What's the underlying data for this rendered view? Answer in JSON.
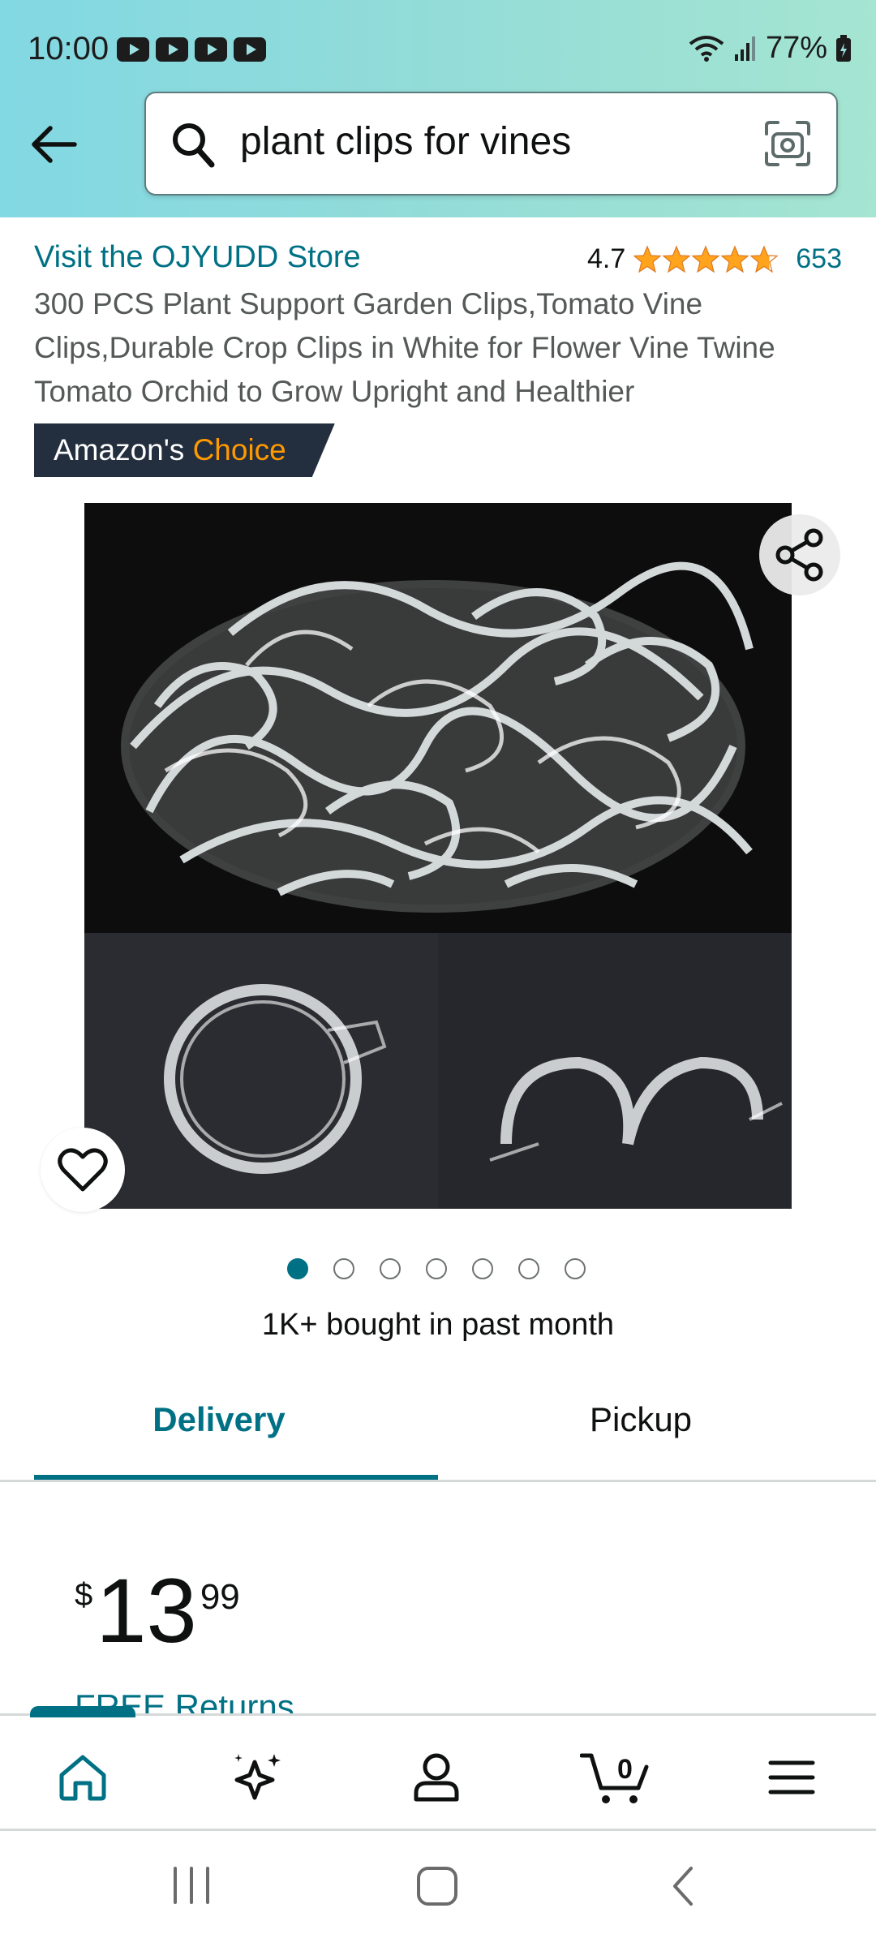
{
  "status_bar": {
    "time": "10:00",
    "notification_icons": [
      "youtube-icon",
      "youtube-icon",
      "youtube-icon",
      "youtube-icon"
    ],
    "battery": "77%"
  },
  "search": {
    "query": "plant clips for vines"
  },
  "product": {
    "store_link": "Visit the OJYUDD Store",
    "rating": "4.7",
    "rating_stars": 4.7,
    "rating_count": "653",
    "title": "300 PCS Plant Support Garden Clips,Tomato Vine Clips,Durable Crop Clips in White for Flower Vine Twine Tomato Orchid to Grow Upright and Healthier",
    "badge_prefix": "Amazon's",
    "badge_highlight": "Choice",
    "image_count": 7,
    "active_image_index": 0,
    "bought_text": "1K+ bought in past month"
  },
  "tabs": {
    "delivery": "Delivery",
    "pickup": "Pickup",
    "active": "delivery"
  },
  "price": {
    "symbol": "$",
    "whole": "13",
    "fraction": "99"
  },
  "free_returns": "FREE Returns",
  "bottom_nav": {
    "items": [
      "home-icon",
      "sparkle-icon",
      "account-icon",
      "cart-icon",
      "menu-icon"
    ],
    "cart_count": "0",
    "active": "home"
  },
  "colors": {
    "accent": "#007185",
    "badge_bg": "#232f3e",
    "badge_highlight": "#ff9900",
    "star": "#ffa41c"
  }
}
